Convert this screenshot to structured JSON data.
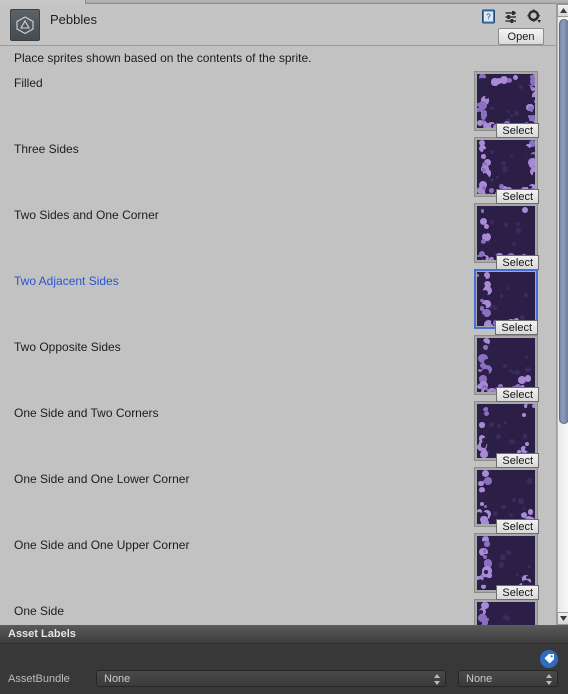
{
  "window": {
    "tab_label": "",
    "title": "Pebbles",
    "icon": "unity-asset-icon",
    "open_button": "Open",
    "header_icons": [
      {
        "name": "help-icon",
        "glyph": "?"
      },
      {
        "name": "preset-icon",
        "glyph": "preset"
      },
      {
        "name": "gear-icon",
        "glyph": "gear"
      }
    ]
  },
  "main": {
    "description": "Place sprites shown based on the contents of the sprite.",
    "select_label": "Select",
    "selected_index": 3,
    "rows": [
      {
        "label": "Filled",
        "pattern": "filled"
      },
      {
        "label": "Three Sides",
        "pattern": "three-sides"
      },
      {
        "label": "Two Sides and One Corner",
        "pattern": "two-sides-one-corner"
      },
      {
        "label": "Two Adjacent Sides",
        "pattern": "two-adjacent-sides"
      },
      {
        "label": "Two Opposite Sides",
        "pattern": "two-opposite-sides"
      },
      {
        "label": "One Side and Two Corners",
        "pattern": "one-side-two-corners"
      },
      {
        "label": "One Side and One Lower Corner",
        "pattern": "one-side-lower-corner"
      },
      {
        "label": "One Side and One Upper Corner",
        "pattern": "one-side-upper-corner"
      },
      {
        "label": "One Side",
        "pattern": "one-side"
      }
    ]
  },
  "scrollbar": {
    "up_arrow": "▲",
    "down_arrow": "▼",
    "thumb_position_percent": 0,
    "thumb_size_percent": 68
  },
  "asset_labels": {
    "header": "Asset Labels",
    "tag_icon": "tag-icon",
    "assetbundle_label": "AssetBundle",
    "bundle_value": "None",
    "variant_value": "None"
  },
  "colors": {
    "accent_blue": "#2a55d4",
    "selection_border": "#4a6ed8",
    "panel_bg": "#c2c2c2",
    "dark_panel": "#383838",
    "sprite_bg": "#2b1f47",
    "pebble": "#a98ad6",
    "tag_button": "#2d6cc0"
  }
}
